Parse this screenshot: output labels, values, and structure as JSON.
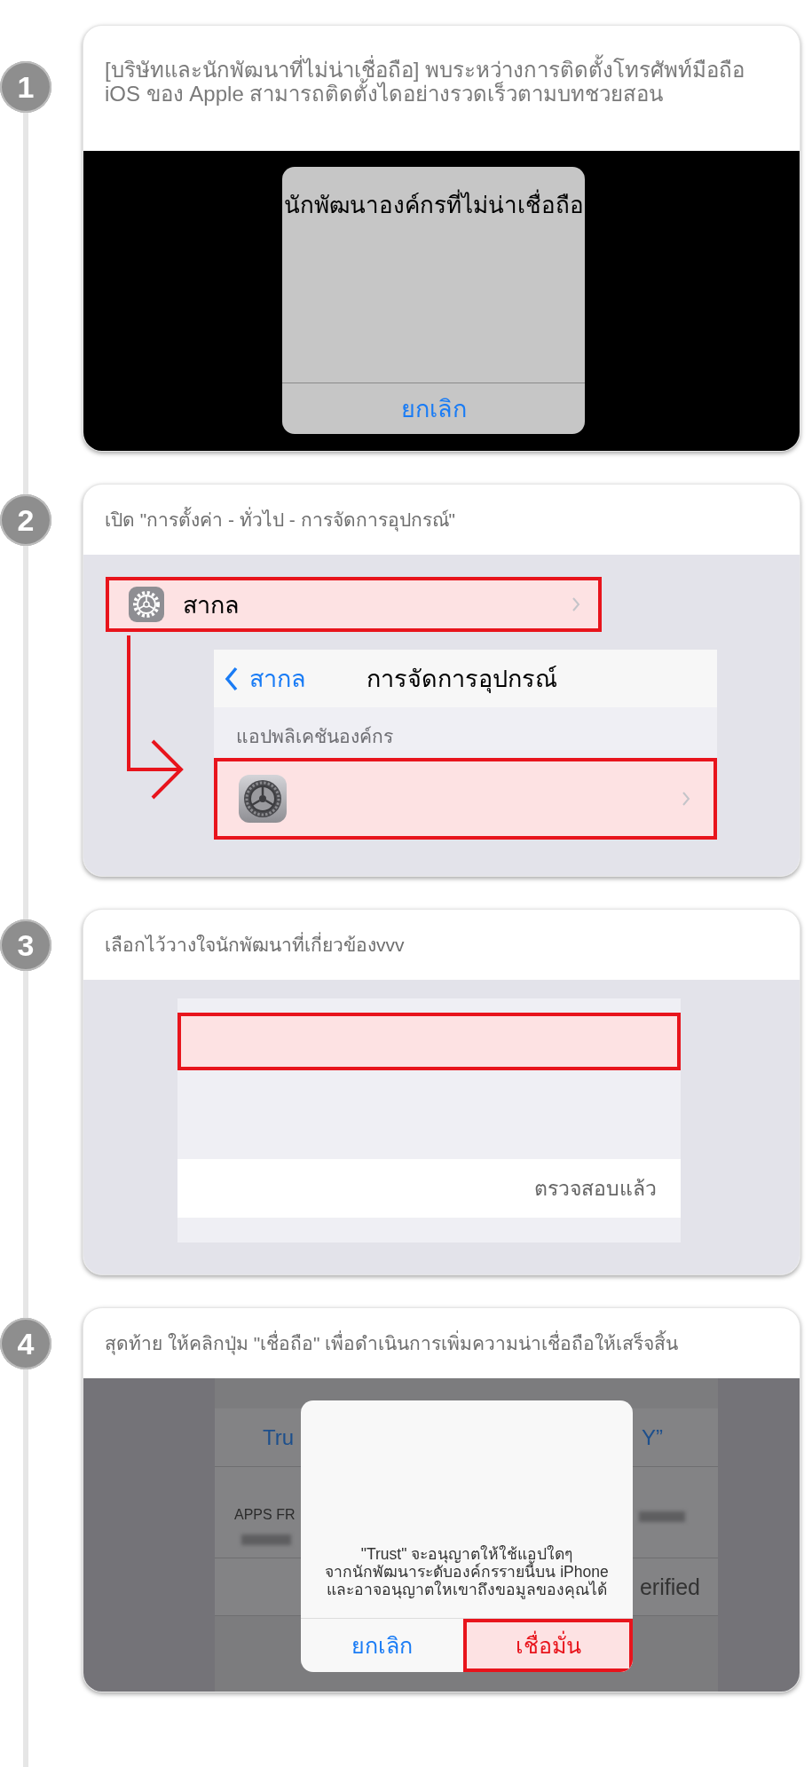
{
  "steps": [
    {
      "number": "1",
      "instruction": "[บริษัทและนักพัฒนาที่ไม่น่าเชื่อถือ] พบระหว่างการติดตั้งโทรศัพท์มือถือ iOS ของ Apple สามารถติดตั้งไดอย่างรวดเร็วตามบทชวยสอน",
      "screen": {
        "kind": "alert",
        "title": "นักพัฒนาองค์กรที่ไม่น่าเชื่อถือ",
        "buttons": [
          {
            "label": "ยกเลิก",
            "highlighted": false
          }
        ]
      }
    },
    {
      "number": "2",
      "instruction": "เปิด \"การตั้งค่า - ทั่วไป - การจัดการอุปกรณ์\"",
      "screen": {
        "kind": "settings",
        "general_row": {
          "label": "สากล",
          "highlighted": true
        },
        "nav_bar": {
          "back": "สากล",
          "title": "การจัดการอุปกรณ์"
        },
        "section_header": "แอปพลิเคชันองค์กร",
        "app_row": {
          "highlighted": true
        }
      }
    },
    {
      "number": "3",
      "instruction": "เลือกไว้วางใจนักพัฒนาที่เกี่ยวข้องvvv",
      "screen": {
        "kind": "trust_list",
        "rows": [
          {
            "kind": "blank",
            "highlighted": true
          },
          {
            "kind": "status",
            "text": "ตรวจสอบแล้ว",
            "highlighted": false
          }
        ]
      }
    },
    {
      "number": "4",
      "instruction": "สุดท้าย ให้คลิกปุ่ม \"เชื่อถือ\" เพื่อดำเนินการเพิ่มความน่าเชื่อถือให้เสร็จสิ้น",
      "screen": {
        "kind": "trust_alert",
        "background_rows": [
          {
            "kind": "link",
            "left": "Tru",
            "right": "Y”"
          },
          {
            "kind": "info",
            "left": "APPS FR"
          },
          {
            "kind": "status",
            "right": "erified"
          }
        ],
        "message": "\"Trust\" จะอนุญาตให้ใช้แอปใดๆ\nจากนักพัฒนาระดับองค์กรรายนี้บน iPhone\nและอาจอนุญาตใหเขาถึงขอมูลของคุณได้",
        "buttons": [
          {
            "label": "ยกเลิก",
            "highlighted": false
          },
          {
            "label": "เชื่อมั่น",
            "highlighted": true
          }
        ]
      }
    }
  ]
}
